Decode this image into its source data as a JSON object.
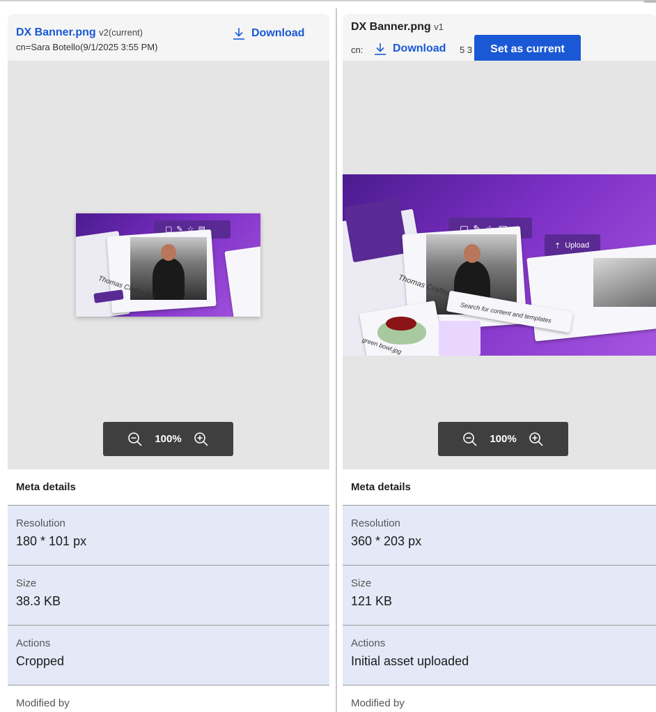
{
  "panels": {
    "left": {
      "file_name": "DX Banner.png",
      "version": "v2(current)",
      "author_line": "cn=Sara Botello(9/1/2025 3:55 PM)",
      "download_label": "Download",
      "zoom_level": "100%",
      "preview_caption": "Thomas Crafter.jpg",
      "meta_title": "Meta details",
      "meta": [
        {
          "label": "Resolution",
          "value": "180 * 101 px"
        },
        {
          "label": "Size",
          "value": "38.3 KB"
        },
        {
          "label": "Actions",
          "value": "Cropped"
        },
        {
          "label": "Modified by",
          "value": ""
        }
      ]
    },
    "right": {
      "file_name": "DX Banner.png",
      "version": "v1",
      "author_line_visible_start": "cn:",
      "author_line_visible_end": "5 3",
      "download_label": "Download",
      "set_current_label": "Set as current",
      "zoom_level": "100%",
      "preview_caption": "Thomas Crafter.jpg",
      "preview_caption_2": "green bowl.jpg",
      "preview_upload": "Upload",
      "preview_search": "Search for content and templates",
      "meta_title": "Meta details",
      "meta": [
        {
          "label": "Resolution",
          "value": "360 * 203 px"
        },
        {
          "label": "Size",
          "value": "121 KB"
        },
        {
          "label": "Actions",
          "value": "Initial asset uploaded"
        },
        {
          "label": "Modified by",
          "value": ""
        }
      ]
    }
  },
  "icons": {
    "download": "download-icon",
    "zoom_out": "zoom-out-icon",
    "zoom_in": "zoom-in-icon"
  },
  "colors": {
    "link_blue": "#1a58d6",
    "meta_row_bg": "#e3e9f7",
    "viewer_bg": "#e5e5e5",
    "zoom_bar_bg": "#3f3f3f"
  }
}
